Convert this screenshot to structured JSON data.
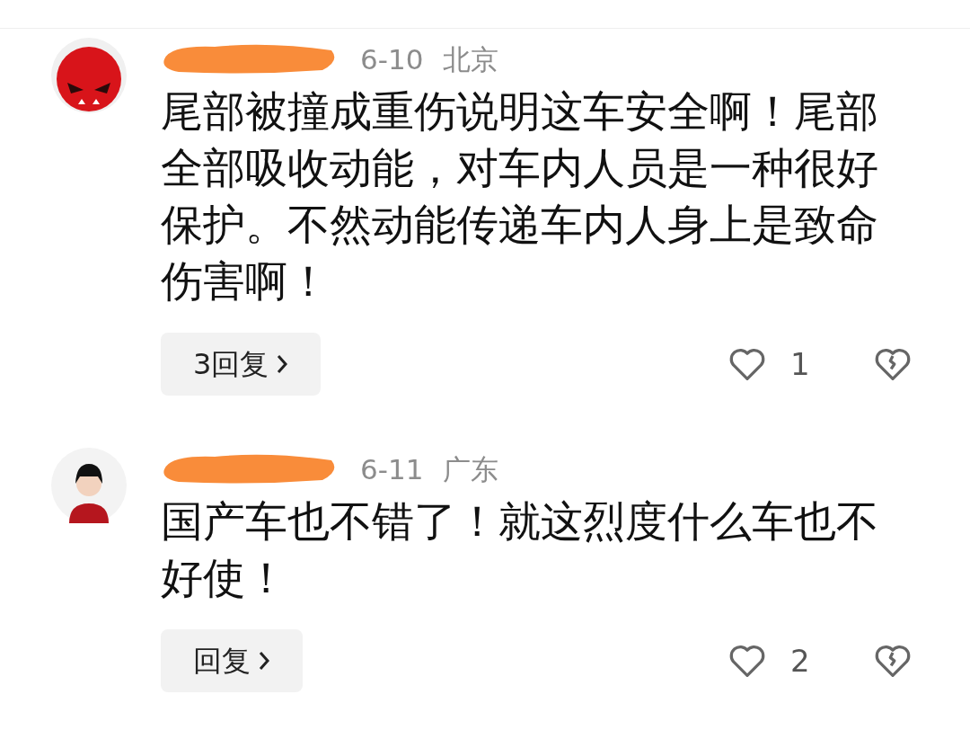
{
  "comments": [
    {
      "avatar": {
        "kind": "devil"
      },
      "date": "6-10",
      "location": "北京",
      "text": "尾部被撞成重伤说明这车安全啊！尾部全部吸收动能，对车内人员是一种很好保护。不然动能传递车内人身上是致命伤害啊！",
      "replies": "3回复",
      "likes": "1"
    },
    {
      "avatar": {
        "kind": "person"
      },
      "date": "6-11",
      "location": "广东",
      "text": "国产车也不错了！就这烈度什么车也不好使！",
      "replies": "回复",
      "likes": "2"
    }
  ]
}
